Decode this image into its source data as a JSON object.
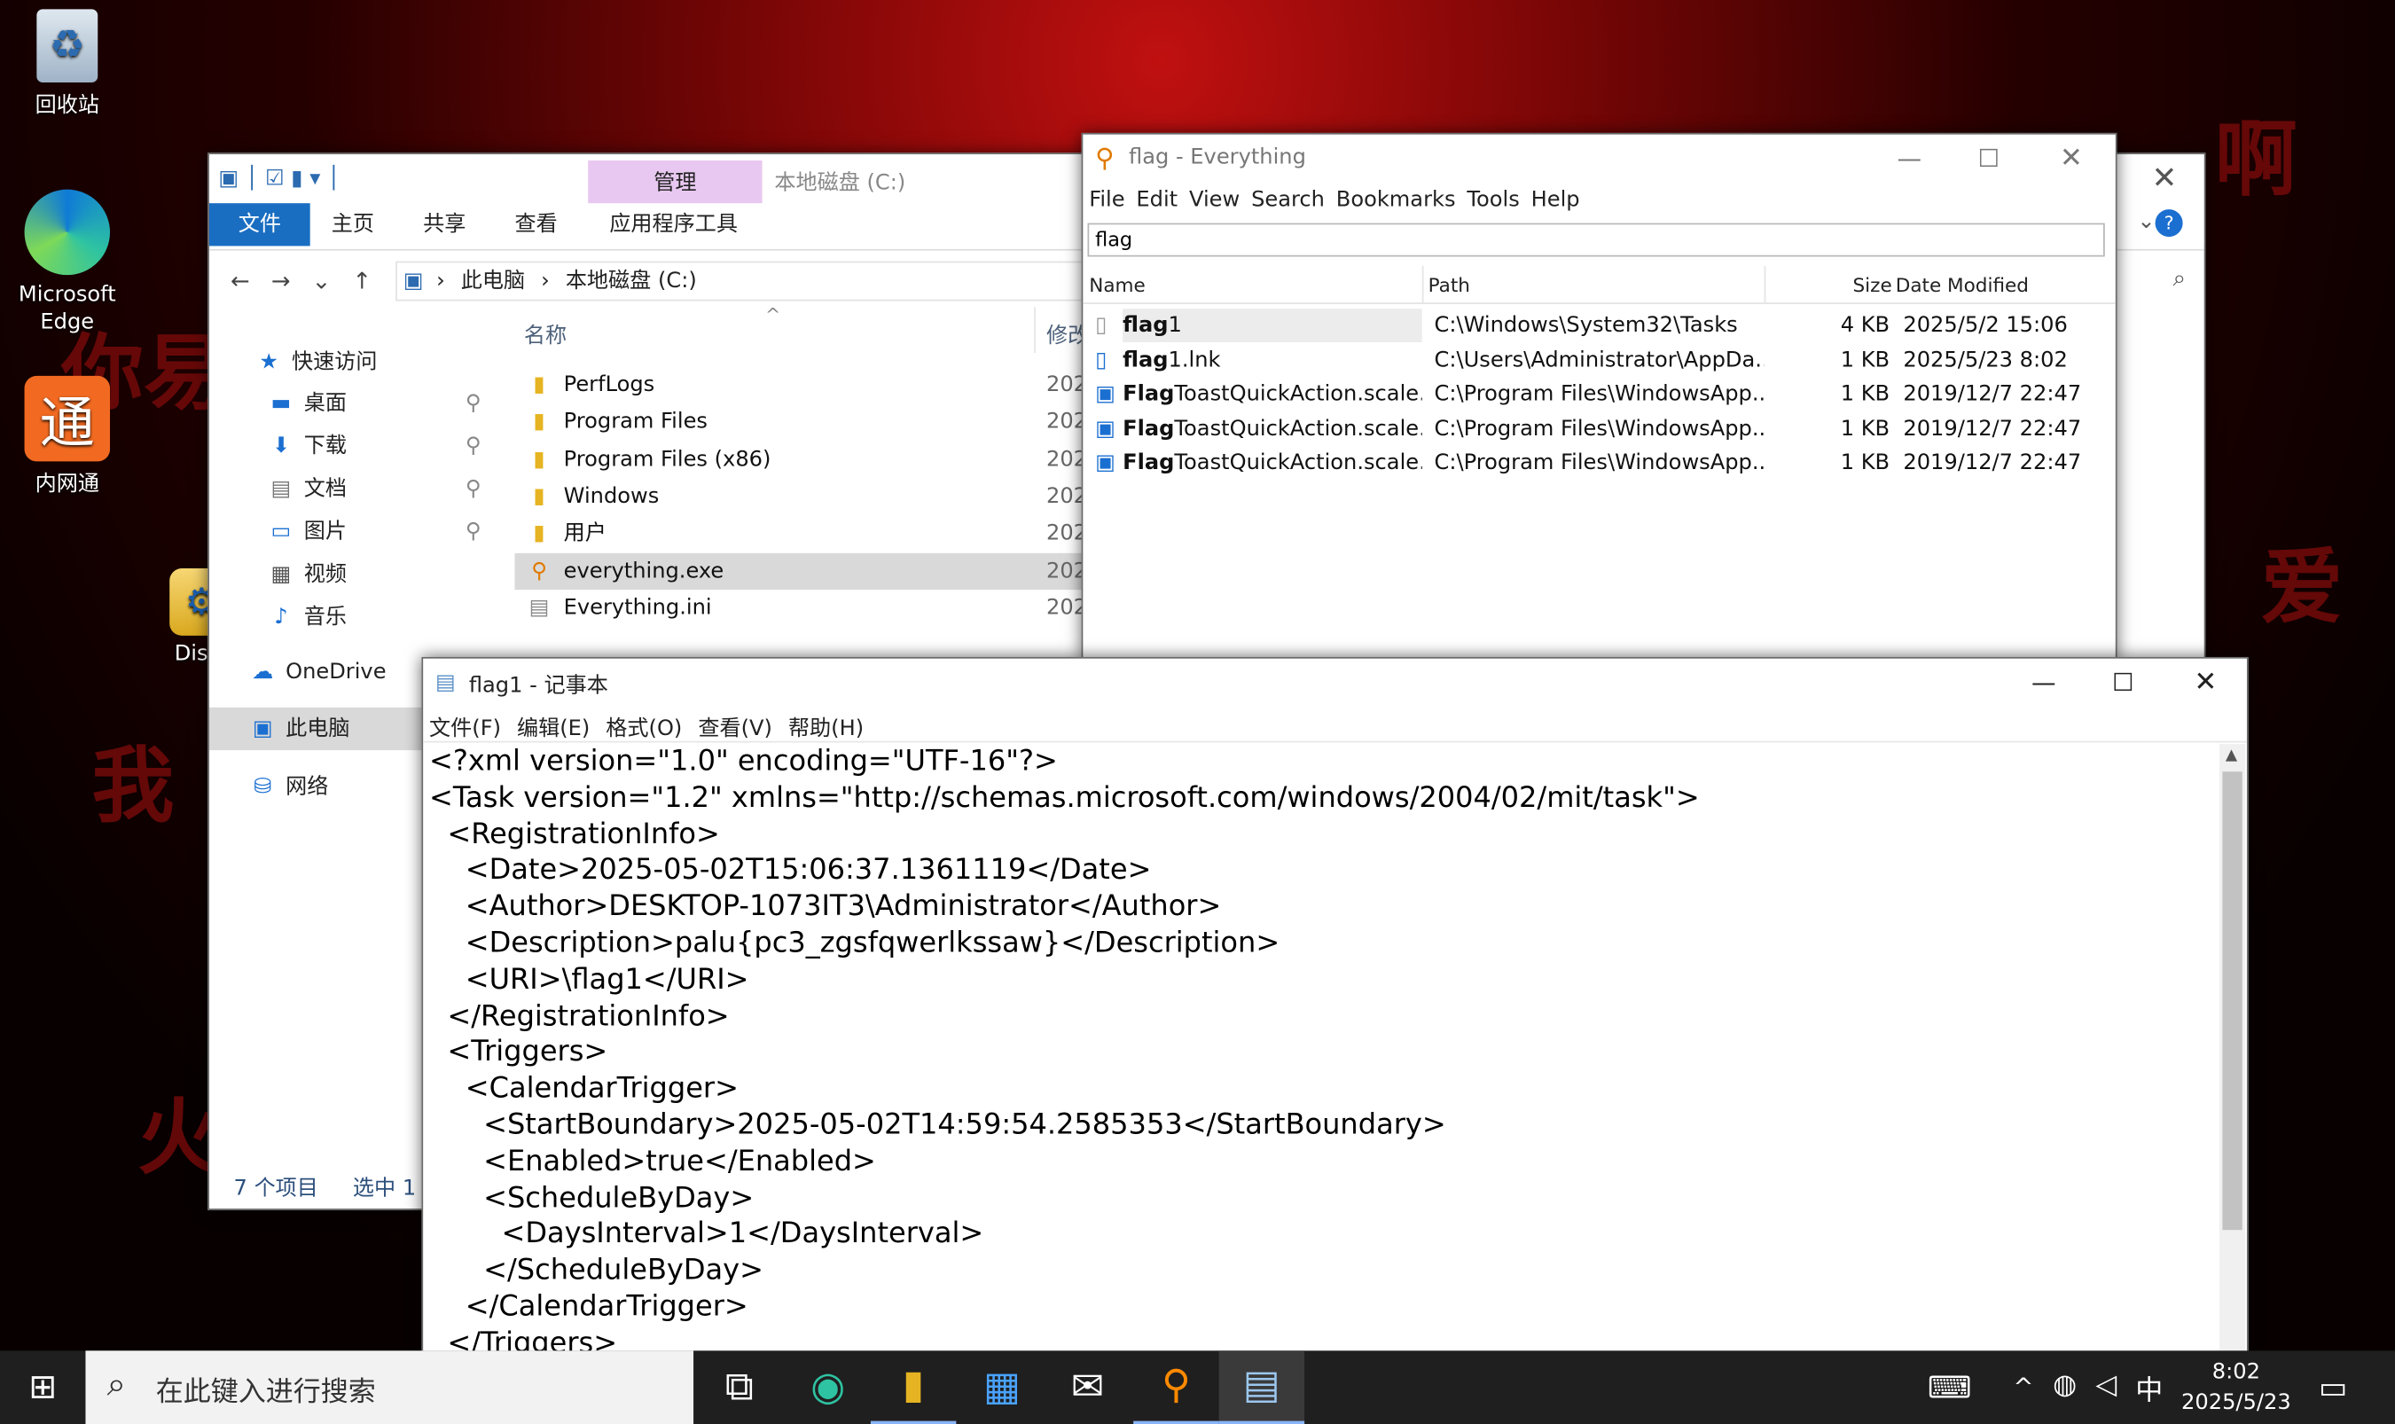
{
  "desktop": {
    "icons": [
      {
        "label": "回收站",
        "icon": "recycle-bin-icon"
      },
      {
        "label": "Microsoft Edge",
        "icon": "edge-icon"
      },
      {
        "label": "内网通",
        "icon": "neiwangtong-icon",
        "glyph": "通"
      },
      {
        "label": "Dism",
        "icon": "dism-folder-icon"
      }
    ]
  },
  "explorer": {
    "title": "本地磁盘 (C:)",
    "contextual_tab_group": "管理",
    "tabs": [
      "文件",
      "主页",
      "共享",
      "查看",
      "应用程序工具"
    ],
    "breadcrumb": [
      "此电脑",
      "本地磁盘 (C:)"
    ],
    "columns": {
      "name": "名称",
      "modified": "修改"
    },
    "nav": {
      "quick_access": "快速访问",
      "items": [
        "桌面",
        "下载",
        "文档",
        "图片",
        "视频",
        "音乐"
      ],
      "onedrive": "OneDrive",
      "this_pc": "此电脑",
      "network": "网络"
    },
    "files": [
      {
        "name": "PerfLogs",
        "date": "202"
      },
      {
        "name": "Program Files",
        "date": "202"
      },
      {
        "name": "Program Files (x86)",
        "date": "202"
      },
      {
        "name": "Windows",
        "date": "202"
      },
      {
        "name": "用户",
        "date": "202"
      },
      {
        "name": "everything.exe",
        "date": "202"
      },
      {
        "name": "Everything.ini",
        "date": "202"
      }
    ],
    "status_count": "7 个项目",
    "status_selected": "选中 1"
  },
  "everything": {
    "title": "flag - Everything",
    "menu": [
      "File",
      "Edit",
      "View",
      "Search",
      "Bookmarks",
      "Tools",
      "Help"
    ],
    "search_value": "flag",
    "columns": {
      "name": "Name",
      "path": "Path",
      "size": "Size",
      "date": "Date Modified"
    },
    "results": [
      {
        "match": "flag",
        "rest": "1",
        "path": "C:\\Windows\\System32\\Tasks",
        "size": "4 KB",
        "date": "2025/5/2 15:06"
      },
      {
        "match": "flag",
        "rest": "1.lnk",
        "path": "C:\\Users\\Administrator\\AppDa...",
        "size": "1 KB",
        "date": "2025/5/23 8:02"
      },
      {
        "match": "Flag",
        "rest": "ToastQuickAction.scale...",
        "path": "C:\\Program Files\\WindowsApp...",
        "size": "1 KB",
        "date": "2019/12/7 22:47"
      },
      {
        "match": "Flag",
        "rest": "ToastQuickAction.scale...",
        "path": "C:\\Program Files\\WindowsApp...",
        "size": "1 KB",
        "date": "2019/12/7 22:47"
      },
      {
        "match": "Flag",
        "rest": "ToastQuickAction.scale...",
        "path": "C:\\Program Files\\WindowsApp...",
        "size": "1 KB",
        "date": "2019/12/7 22:47"
      }
    ]
  },
  "notepad": {
    "title": "flag1 - 记事本",
    "menu": [
      "文件(F)",
      "编辑(E)",
      "格式(O)",
      "查看(V)",
      "帮助(H)"
    ],
    "lines": [
      "<?xml version=\"1.0\" encoding=\"UTF-16\"?>",
      "<Task version=\"1.2\" xmlns=\"http://schemas.microsoft.com/windows/2004/02/mit/task\">",
      "  <RegistrationInfo>",
      "    <Date>2025-05-02T15:06:37.1361119</Date>",
      "    <Author>DESKTOP-1073IT3\\Administrator</Author>",
      "    <Description>palu{pc3_zgsfqwerlkssaw}</Description>",
      "    <URI>\\flag1</URI>",
      "  </RegistrationInfo>",
      "  <Triggers>",
      "    <CalendarTrigger>",
      "      <StartBoundary>2025-05-02T14:59:54.2585353</StartBoundary>",
      "      <Enabled>true</Enabled>",
      "      <ScheduleByDay>",
      "        <DaysInterval>1</DaysInterval>",
      "      </ScheduleByDay>",
      "    </CalendarTrigger>",
      "  </Triggers>"
    ]
  },
  "taskbar": {
    "search_placeholder": "在此键入进行搜索",
    "time": "8:02",
    "date": "2025/5/23",
    "ime": "中",
    "apps": [
      "task-view-icon",
      "edge-icon",
      "file-explorer-icon",
      "store-icon",
      "mail-icon",
      "everything-icon",
      "notepad-icon"
    ]
  }
}
